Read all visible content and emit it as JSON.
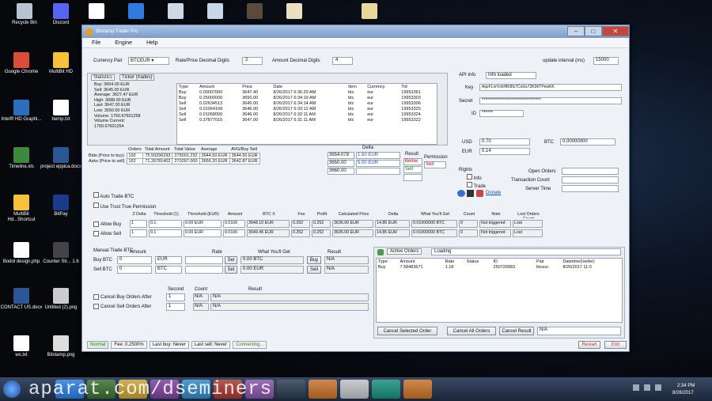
{
  "desktop": {
    "icons": [
      {
        "label": "Recycle Bin",
        "color": "#b8c4d0"
      },
      {
        "label": "Discord",
        "color": "#5865f2"
      },
      {
        "label": "",
        "color": "#ffffff"
      },
      {
        "label": "",
        "color": "#2f7be0"
      },
      {
        "label": "",
        "color": "#d0d8e6"
      },
      {
        "label": "",
        "color": "#c8d6ea"
      },
      {
        "label": "",
        "color": "#5a4a3a"
      },
      {
        "label": "",
        "color": "#e8e0c0"
      },
      {
        "label": "",
        "color": "#e8d89a"
      },
      {
        "label": "Google Chrome",
        "color": "#dd4b39"
      },
      {
        "label": "MultiBit HD",
        "color": "#f7c23a"
      },
      {
        "label": "Intel® HD Graphi...",
        "color": "#2a6fbf"
      },
      {
        "label": "bemp.txt",
        "color": "#ffffff"
      },
      {
        "label": "Timeline.xls",
        "color": "#3b8a3e"
      },
      {
        "label": "project eppica.docx",
        "color": "#2b5797"
      },
      {
        "label": "MultiBit Hd...Shortcut",
        "color": "#f7c23a"
      },
      {
        "label": "BitPay",
        "color": "#1a3b8c"
      },
      {
        "label": "Bodol design.php",
        "color": "#ffffff"
      },
      {
        "label": "Counter Str... 1.6",
        "color": "#444"
      },
      {
        "label": "CONTACT US.docx",
        "color": "#2b5797"
      },
      {
        "label": "Untitled (2).png",
        "color": "#ccc"
      },
      {
        "label": "ws.txt",
        "color": "#fff"
      },
      {
        "label": "Bitstamp.png",
        "color": "#ddd"
      }
    ]
  },
  "window": {
    "title": "Bitstamp Trader Pro",
    "menu": [
      "File",
      "Engine",
      "Help"
    ]
  },
  "top": {
    "currency_pair_label": "Currency Pair",
    "currency_pair": "BTCEUR",
    "rate_digits_label": "Rate/Price Decimal Digits",
    "rate_digits": "2",
    "amount_digits_label": "Amount Decimal Digits",
    "amount_digits": "4",
    "update_interval_label": "update interval (ms)",
    "update_interval": "15000"
  },
  "stats": {
    "tab1": "Statistics",
    "tab2": "Ticker (trades)",
    "lines": [
      "Buy: 3654.00 EUR",
      "Sell: 3645.00 EUR",
      "Average: 3627.47 EUR",
      "High: 3688.00 EUR",
      "Last: 3647.00 EUR",
      "Low: 3550.00 EUR",
      "Volume: 1750.67601258",
      "Volume Current:",
      "1750.67601254"
    ]
  },
  "trades": {
    "headers": [
      "Type",
      "Amount",
      "Price",
      "Date",
      "Item",
      "Currency",
      "Tid"
    ],
    "rows": [
      [
        "Buy",
        "0.00007000",
        "3647.40",
        "8/26/2017 6:36:20 AM",
        "btc",
        "eur",
        "19953361"
      ],
      [
        "Buy",
        "0.25000000",
        "3650.00",
        "8/26/2017 6:34:19 AM",
        "btc",
        "eur",
        "19953303"
      ],
      [
        "Sell",
        "0.02634513",
        "3645.00",
        "8/26/2017 6:34:14 AM",
        "btc",
        "eur",
        "19953306"
      ],
      [
        "Sell",
        "0.01064108",
        "3646.00",
        "8/26/2017 6:33:12 AM",
        "btc",
        "eur",
        "19953325"
      ],
      [
        "Sell",
        "0.01058000",
        "3646.00",
        "8/26/2017 6:32:11 AM",
        "btc",
        "eur",
        "19953324"
      ],
      [
        "Sell",
        "0.37877015",
        "3647.00",
        "8/26/2017 6:31:11 AM",
        "btc",
        "eur",
        "19953322"
      ]
    ]
  },
  "orderbook": {
    "headers": [
      "Orders",
      "Total Amount",
      "Total Value",
      "Average",
      "AVG/Buy Sell"
    ],
    "bid_label": "Bids (Price to buy)",
    "ask_label": "Asks (Price to sell)",
    "bid": [
      "192",
      "75.50296293",
      "275001.232",
      "3644.50 EUR",
      "3644.50 EUR"
    ],
    "ask": [
      "162",
      "71.26781402",
      "270267.000",
      "3656.20 EUR",
      "3642.87 EUR"
    ],
    "delta_header": "Delta",
    "result_header": "Result",
    "permission_header": "Permission",
    "deltas": [
      "3654.078",
      "3650.00",
      "3660.00"
    ],
    "delta_eur": [
      "1.50 EUR",
      "5.00 EUR",
      ""
    ],
    "results": [
      "Below",
      "Sell",
      ""
    ],
    "permission": "Sell"
  },
  "auto": {
    "auto_trade": "Auto Trade BTC",
    "trust": "Use Trust True Permission",
    "headers": [
      "Z Delta",
      "Threshold (1)",
      "Threshold (EUR)",
      "Amount",
      "BTC X",
      "Fee",
      "Profit",
      "Calculated Price",
      "Delta",
      "What You'll Get",
      "Count",
      "Note",
      "Lost Orders Count"
    ],
    "buy_label": "Allow Buy",
    "sell_label": "Allow Sell",
    "buy": [
      "1",
      "0.1",
      "0.00 EUR",
      "0.0106",
      "3648.10 EUR",
      "0.252",
      "0.252",
      "3636.00 EUR",
      "14.85 EUR",
      "0.01000000 BTC",
      "0",
      "Not triggered",
      "Lost"
    ],
    "sell": [
      "1",
      "0.1",
      "0.00 EUR",
      "0.0106",
      "3649.45 EUR",
      "0.252",
      "0.252",
      "3636.00 EUR",
      "14.85 EUR",
      "0.01000000 BTC",
      "0",
      "Not triggered",
      "Lost"
    ]
  },
  "manual": {
    "title": "Manual Trade BTC",
    "amount_h": "Amount",
    "rate_h": "Rate",
    "get_h": "What You'll Get",
    "result_h": "Result",
    "buy_label": "Buy BTC",
    "sell_label": "Sell BTC",
    "buy_amt": "0",
    "sell_amt": "0",
    "buy_cur": "EUR",
    "sell_cur": "BTC",
    "set": "Set",
    "buy_get": "0.00 BTC",
    "sell_get": "0.00 EUR",
    "buy_btn": "Buy",
    "sell_btn": "Sell",
    "buy_res": "N/A",
    "sell_res": "N/A"
  },
  "cancel": {
    "second_h": "Second",
    "count_h": "Count",
    "result_h": "Result",
    "buy_label": "Cancel Buy Orders After",
    "sell_label": "Cancel Sell Orders After",
    "buy_sec": "1",
    "sell_sec": "1",
    "buy_count": "N/A",
    "sell_count": "N/A",
    "buy_res": "N/A",
    "sell_res": "N/A"
  },
  "api": {
    "label": "API Info",
    "status": "Info loaded",
    "key_label": "Key",
    "key": "AqzFLnrVxhHlK8fz7CoGs73K9hTPewKK",
    "secret_label": "Secret",
    "secret": "********************************",
    "id_label": "ID",
    "id": "******",
    "usd_label": "USD",
    "usd": "0.70",
    "eur_label": "EUR",
    "eur": "0.14",
    "btc_label": "BTC",
    "btc": "0.00000000"
  },
  "rights": {
    "label": "Rights",
    "info": "Info",
    "trade": "Trade",
    "donate": "Donate",
    "open_orders": "Open Orders",
    "transaction_count": "Transaction Count",
    "server_time": "Server Time"
  },
  "active": {
    "tab1": "Active Orders",
    "tab2": "Loading",
    "headers": [
      "Type",
      "Amount",
      "Rate",
      "Status",
      "ID",
      "Pair",
      "Datetime(Iseller)"
    ],
    "rows": [
      [
        "Buy",
        "7.58483671",
        "1.18",
        "",
        "250720983",
        "btceur",
        "8/26/2017 11:0"
      ]
    ],
    "btn_cancel_selected": "Cancel Selected Order",
    "btn_cancel_all": "Cancel All Orders",
    "cancel_result_label": "Cancel Result",
    "cancel_result": "N/A"
  },
  "status": {
    "items": [
      "Normal",
      "Fee: 0.2500%",
      "Last buy: Never",
      "Last sell: Never",
      "Connecting..."
    ],
    "restart": "Restart",
    "exit": "Exit"
  },
  "taskbar": {
    "watermark": "aparat.com/dseminers",
    "time": "2:34 PM",
    "date": "8/26/2017"
  }
}
